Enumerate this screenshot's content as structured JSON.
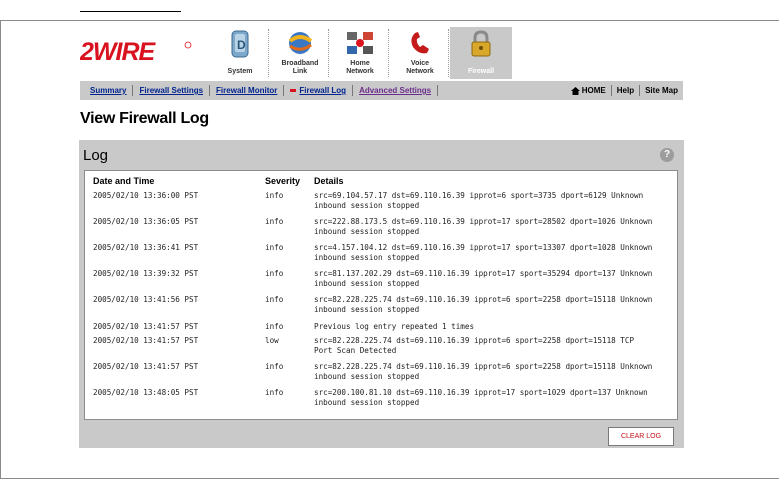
{
  "brand": {
    "logo_text": "2WIRE"
  },
  "nav_tabs": [
    {
      "label": "System",
      "icon": "system-icon"
    },
    {
      "label": "Broadband\nLink",
      "icon": "broadband-icon"
    },
    {
      "label": "Home\nNetwork",
      "icon": "home-network-icon"
    },
    {
      "label": "Voice\nNetwork",
      "icon": "voice-network-icon"
    },
    {
      "label": "Firewall",
      "icon": "firewall-lock-icon",
      "active": true
    }
  ],
  "subnav": {
    "items": [
      "Summary",
      "Firewall Settings",
      "Firewall Monitor",
      "Firewall Log",
      "Advanced Settings"
    ],
    "current": "Firewall Log",
    "right": {
      "home": "HOME",
      "help": "Help",
      "sitemap": "Site Map"
    }
  },
  "page_title": "View Firewall Log",
  "panel": {
    "title": "Log",
    "help": "?",
    "columns": {
      "datetime": "Date and Time",
      "severity": "Severity",
      "details": "Details"
    },
    "rows": [
      {
        "datetime": "2005/02/10 13:36:00 PST",
        "severity": "info",
        "details": "src=69.104.57.17 dst=69.110.16.39 ipprot=6 sport=3735 dport=6129 Unknown inbound session stopped"
      },
      {
        "datetime": "2005/02/10 13:36:05 PST",
        "severity": "info",
        "details": "src=222.88.173.5 dst=69.110.16.39 ipprot=17 sport=28502 dport=1026 Unknown inbound session stopped"
      },
      {
        "datetime": "2005/02/10 13:36:41 PST",
        "severity": "info",
        "details": "src=4.157.104.12 dst=69.110.16.39 ipprot=17 sport=13307 dport=1028 Unknown inbound session stopped"
      },
      {
        "datetime": "2005/02/10 13:39:32 PST",
        "severity": "info",
        "details": "src=81.137.202.29 dst=69.110.16.39 ipprot=17 sport=35294 dport=137 Unknown inbound session stopped"
      },
      {
        "datetime": "2005/02/10 13:41:56 PST",
        "severity": "info",
        "details": "src=82.228.225.74 dst=69.110.16.39 ipprot=6 sport=2258 dport=15118 Unknown inbound session stopped"
      },
      {
        "datetime": "2005/02/10 13:41:57 PST",
        "severity": "info",
        "details": "Previous log entry repeated 1 times"
      },
      {
        "datetime": "2005/02/10 13:41:57 PST",
        "severity": "low",
        "details": "src=82.228.225.74 dst=69.110.16.39 ipprot=6 sport=2258 dport=15118 TCP Port Scan Detected"
      },
      {
        "datetime": "2005/02/10 13:41:57 PST",
        "severity": "info",
        "details": "src=82.228.225.74 dst=69.110.16.39 ipprot=6 sport=2258 dport=15118 Unknown inbound session stopped"
      },
      {
        "datetime": "2005/02/10 13:48:05 PST",
        "severity": "info",
        "details": "src=200.100.81.10 dst=69.110.16.39 ipprot=17 sport=1029 dport=137 Unknown inbound session stopped"
      }
    ],
    "clear_button": "CLEAR LOG"
  },
  "colors": {
    "accent_red": "#d9121f",
    "link_blue": "#00248f",
    "panel_gray": "#c9c9c9"
  }
}
